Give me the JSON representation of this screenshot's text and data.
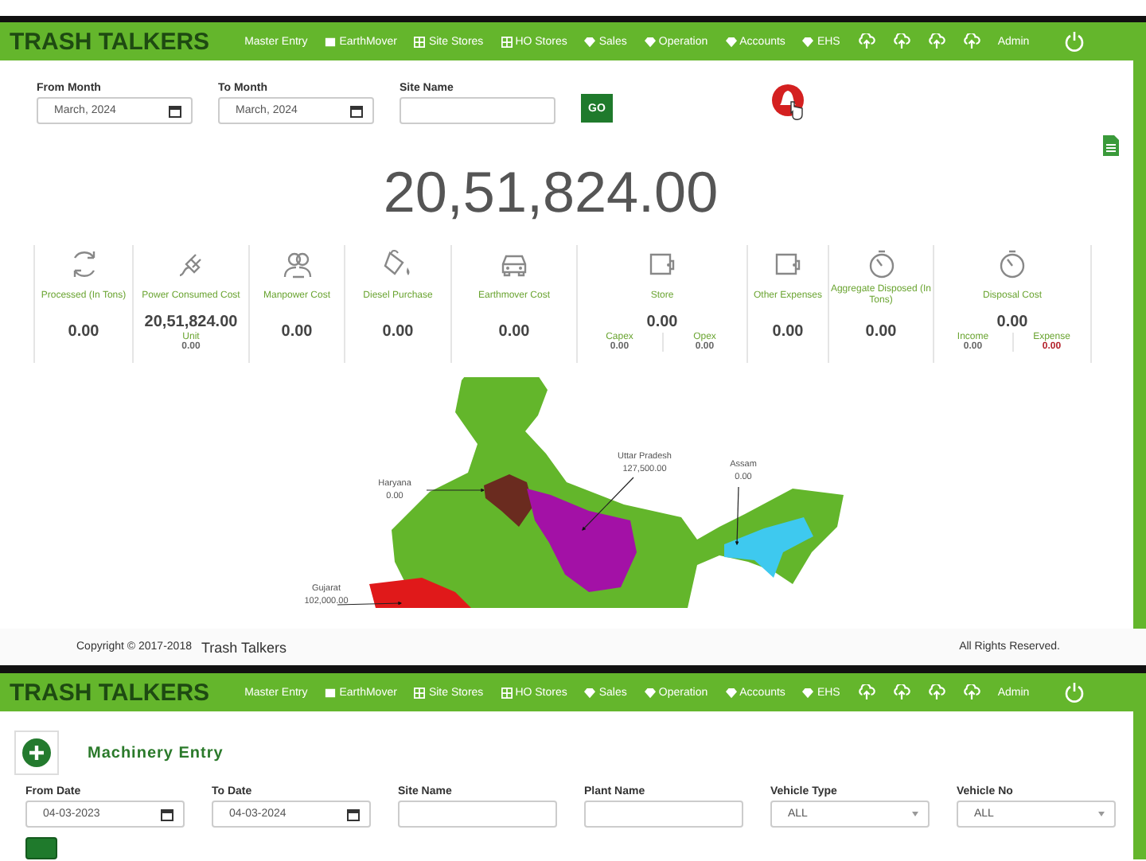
{
  "dashboard": {
    "nav": {
      "brand": "TRASH TALKERS",
      "items": [
        {
          "kind": "plain",
          "label": "Master Entry"
        },
        {
          "kind": "box",
          "label": "EarthMover"
        },
        {
          "kind": "table",
          "label": "Site Stores"
        },
        {
          "kind": "table",
          "label": "HO Stores"
        },
        {
          "kind": "gem",
          "label": "Sales"
        },
        {
          "kind": "gem",
          "label": "Operation"
        },
        {
          "kind": "gem",
          "label": "Accounts"
        },
        {
          "kind": "gem",
          "label": "EHS"
        },
        {
          "kind": "cloud"
        },
        {
          "kind": "cloud"
        },
        {
          "kind": "cloud"
        },
        {
          "kind": "cloud"
        },
        {
          "kind": "plain",
          "label": "Admin"
        },
        {
          "kind": "power"
        }
      ]
    },
    "filters": [
      {
        "kind": "date",
        "label": "From Month",
        "value": "March, 2024"
      },
      {
        "kind": "date",
        "label": "To Month",
        "value": "March, 2024"
      },
      {
        "kind": "text",
        "label": "Site Name"
      }
    ],
    "go_button": "GO",
    "total": "20,51,824.00",
    "stats": [
      {
        "kind": "processed",
        "label": "Processed (In Tons)",
        "value": "0.00"
      },
      {
        "kind": "power",
        "label": "Power Consumed Cost",
        "value": "20,51,824.00",
        "subs": [
          {
            "label": "Unit",
            "value": "0.00",
            "negative": false
          }
        ]
      },
      {
        "kind": "manpower",
        "label": "Manpower Cost",
        "value": "0.00"
      },
      {
        "kind": "diesel",
        "label": "Diesel Purchase",
        "value": "0.00"
      },
      {
        "kind": "earthmover",
        "label": "Earthmover Cost",
        "value": "0.00"
      },
      {
        "kind": "store",
        "label": "Store",
        "value": "0.00",
        "subs": [
          {
            "label": "Capex",
            "value": "0.00",
            "negative": false
          },
          {
            "label": "Opex",
            "value": "0.00",
            "negative": false
          }
        ]
      },
      {
        "kind": "expenses",
        "label": "Other Expenses",
        "value": "0.00"
      },
      {
        "kind": "aggregate",
        "label": "Aggregate Disposed (In Tons)",
        "value": "0.00"
      },
      {
        "kind": "disposal",
        "label": "Disposal Cost",
        "value": "0.00",
        "subs": [
          {
            "label": "Income",
            "value": "0.00",
            "negative": false
          },
          {
            "label": "Expense",
            "value": "0.00",
            "negative": true
          }
        ]
      }
    ],
    "map": {
      "regions": [
        {
          "name": "Haryana",
          "value": "0.00",
          "color": "#6a2b1f"
        },
        {
          "name": "Uttar Pradesh",
          "value": "127,500.00",
          "color": "#a311a6"
        },
        {
          "name": "Assam",
          "value": "0.00",
          "color": "#3ec9ef"
        },
        {
          "name": "Gujarat",
          "value": "102,000.00",
          "color": "#e0191a"
        }
      ]
    },
    "footer": {
      "copyright": "Copyright © 2017-2018",
      "company": "Trash Talkers",
      "rights": "All Rights Reserved."
    }
  },
  "machinery": {
    "nav": {
      "brand": "TRASH TALKERS",
      "items": [
        {
          "kind": "plain",
          "label": "Master Entry"
        },
        {
          "kind": "box",
          "label": "EarthMover"
        },
        {
          "kind": "table",
          "label": "Site Stores"
        },
        {
          "kind": "table",
          "label": "HO Stores"
        },
        {
          "kind": "gem",
          "label": "Sales"
        },
        {
          "kind": "gem",
          "label": "Operation"
        },
        {
          "kind": "gem",
          "label": "Accounts"
        },
        {
          "kind": "gem",
          "label": "EHS"
        },
        {
          "kind": "cloud"
        },
        {
          "kind": "cloud"
        },
        {
          "kind": "cloud"
        },
        {
          "kind": "cloud"
        },
        {
          "kind": "plain",
          "label": "Admin"
        },
        {
          "kind": "power"
        }
      ]
    },
    "title": "Machinery Entry",
    "filters": [
      {
        "kind": "date",
        "label": "From Date",
        "value": "04-03-2023"
      },
      {
        "kind": "date",
        "label": "To Date",
        "value": "04-03-2024"
      },
      {
        "kind": "text",
        "label": "Site Name"
      },
      {
        "kind": "text",
        "label": "Plant Name"
      },
      {
        "kind": "select",
        "label": "Vehicle Type",
        "value": "ALL"
      },
      {
        "kind": "select",
        "label": "Vehicle No",
        "value": "ALL"
      }
    ]
  }
}
